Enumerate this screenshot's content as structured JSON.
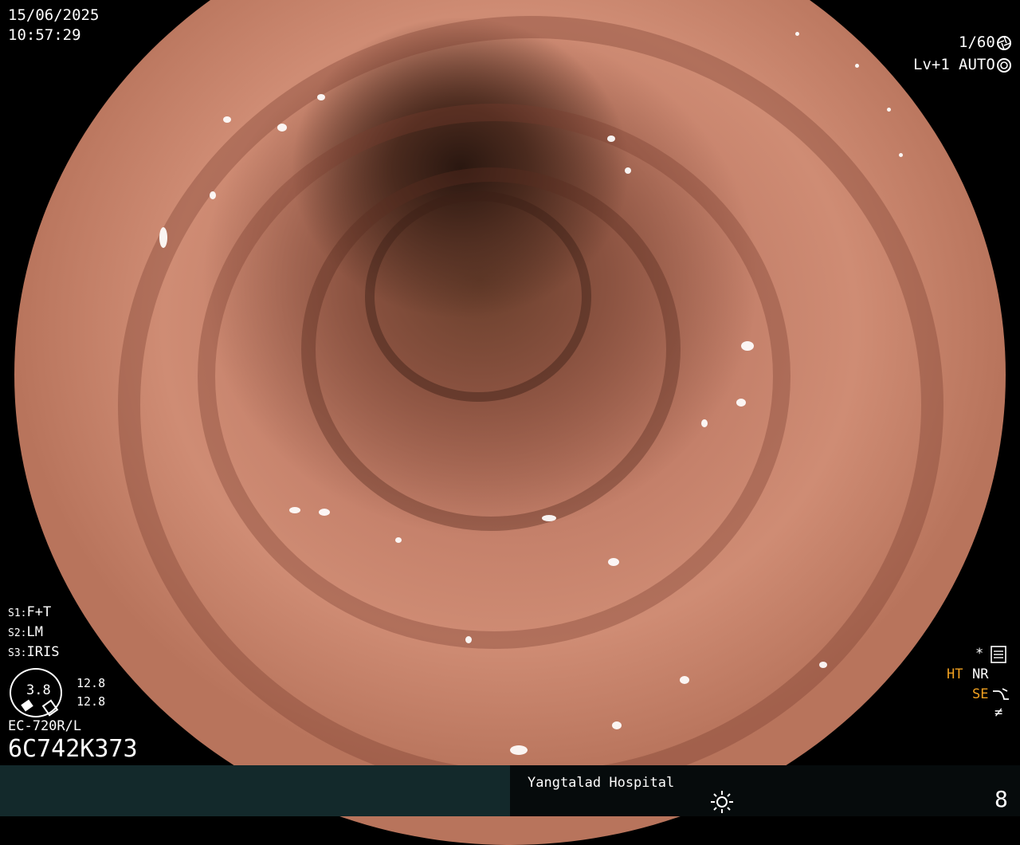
{
  "overlay": {
    "date": "15/06/2025",
    "time": "10:57:29",
    "shutter": "1/60",
    "level": "Lv+1",
    "iris_mode": "AUTO",
    "settings": [
      {
        "key": "S1:",
        "value": "F+T"
      },
      {
        "key": "S2:",
        "value": "LM"
      },
      {
        "key": "S3:",
        "value": "IRIS"
      }
    ],
    "gauge_value": "3.8",
    "gauge_readings": [
      "12.8",
      "12.8"
    ],
    "scope_model": "EC-720R/L",
    "serial": "6C742K373",
    "right_flags": {
      "star": "*",
      "ht": "HT",
      "nr": "NR",
      "se": "SE",
      "slash": "≠"
    },
    "hospital": "Yangtalad Hospital",
    "index_number": "8"
  },
  "colors": {
    "bottom_left_bar": "#13292b",
    "bottom_right_bar": "#060b0c",
    "highlight": "#f0a020",
    "mucosa": "#c4806a"
  },
  "icons": {
    "shutter": "aperture-icon",
    "auto": "iris-icon",
    "menu": "settings-card-icon",
    "se": "curve-arrow-icon",
    "light": "sun-icon"
  }
}
